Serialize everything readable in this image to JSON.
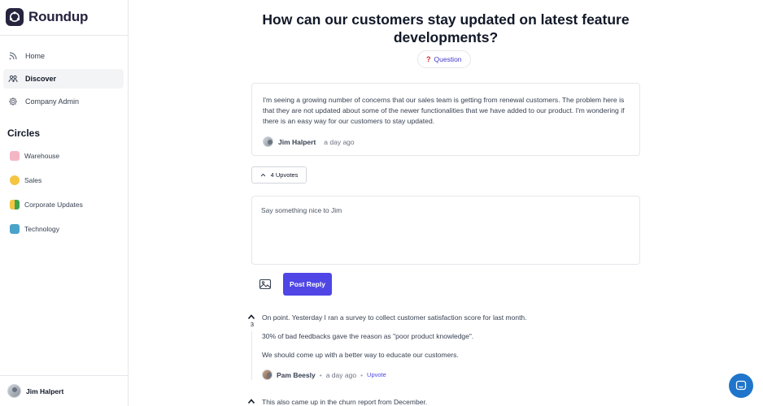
{
  "brand": {
    "name": "Roundup"
  },
  "nav": [
    {
      "label": "Home",
      "icon": "rss-icon"
    },
    {
      "label": "Discover",
      "icon": "people-icon",
      "active": true
    },
    {
      "label": "Company Admin",
      "icon": "gear-icon"
    }
  ],
  "circles": {
    "title": "Circles",
    "items": [
      {
        "label": "Warehouse",
        "icon": "warehouse-emoji-icon",
        "color": "#f1a7b8"
      },
      {
        "label": "Sales",
        "icon": "money-face-emoji-icon",
        "color": "#f5c542"
      },
      {
        "label": "Corporate Updates",
        "icon": "beginner-emoji-icon",
        "color": "#3fa34d"
      },
      {
        "label": "Technology",
        "icon": "robot-emoji-icon",
        "color": "#4aa3c9"
      }
    ]
  },
  "current_user": {
    "name": "Jim Halpert"
  },
  "question": {
    "title": "How can our customers stay updated on latest feature developments?",
    "badge": "Question",
    "body": "I'm seeing a growing number of concerns that our sales team is getting from renewal customers. The problem here is that they are not updated about some of the newer functionalities that we have added to our product. I'm wondering if there is an easy way for our customers to stay updated.",
    "author": "Jim Halpert",
    "time": "a day ago",
    "upvotes_label": "4 Upvotes"
  },
  "reply": {
    "placeholder": "Say something nice to Jim",
    "button": "Post Reply"
  },
  "comments": [
    {
      "votes": "3",
      "paragraphs": [
        "On point. Yesterday I ran a survey to collect customer satisfaction score for last month.",
        "30% of bad feedbacks gave the reason as \"poor product knowledge\".",
        "We should come up with a better way to educate our customers."
      ],
      "author": "Pam Beesly",
      "time": "a day ago",
      "upvote_label": "Upvote"
    },
    {
      "paragraphs": [
        "This also came up in the churn report from December."
      ]
    }
  ],
  "colors": {
    "accent": "#4f46e5",
    "brand": "#26233f",
    "chat": "#1f75cb"
  }
}
